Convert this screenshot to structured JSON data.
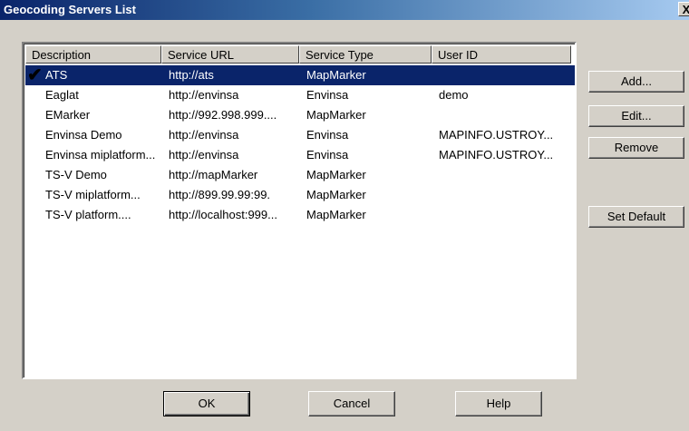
{
  "window": {
    "title": "Geocoding Servers List",
    "close_label": "X"
  },
  "table": {
    "columns": [
      "Description",
      "Service URL",
      "Service Type",
      "User ID"
    ],
    "rows": [
      {
        "description": "ATS",
        "url": "http://ats",
        "type": "MapMarker",
        "user": "",
        "selected": true,
        "default": true
      },
      {
        "description": "Eaglat",
        "url": "http://envinsa",
        "type": "Envinsa",
        "user": "demo"
      },
      {
        "description": "EMarker",
        "url": "http://992.998.999....",
        "type": "MapMarker",
        "user": ""
      },
      {
        "description": "Envinsa Demo",
        "url": "http://envinsa",
        "type": "Envinsa",
        "user": "MAPINFO.USTROY..."
      },
      {
        "description": "Envinsa miplatform...",
        "url": "http://envinsa",
        "type": "Envinsa",
        "user": "MAPINFO.USTROY..."
      },
      {
        "description": "TS-V Demo",
        "url": "http://mapMarker",
        "type": "MapMarker",
        "user": ""
      },
      {
        "description": "TS-V miplatform...",
        "url": "http://899.99.99:99.",
        "type": "MapMarker",
        "user": ""
      },
      {
        "description": "TS-V platform....",
        "url": "http://localhost:999...",
        "type": "MapMarker",
        "user": ""
      }
    ]
  },
  "buttons": {
    "add": "Add...",
    "edit": "Edit...",
    "remove": "Remove",
    "set_default": "Set Default",
    "ok": "OK",
    "cancel": "Cancel",
    "help": "Help"
  },
  "colors": {
    "selection": "#0a246a",
    "face": "#d4d0c8"
  }
}
